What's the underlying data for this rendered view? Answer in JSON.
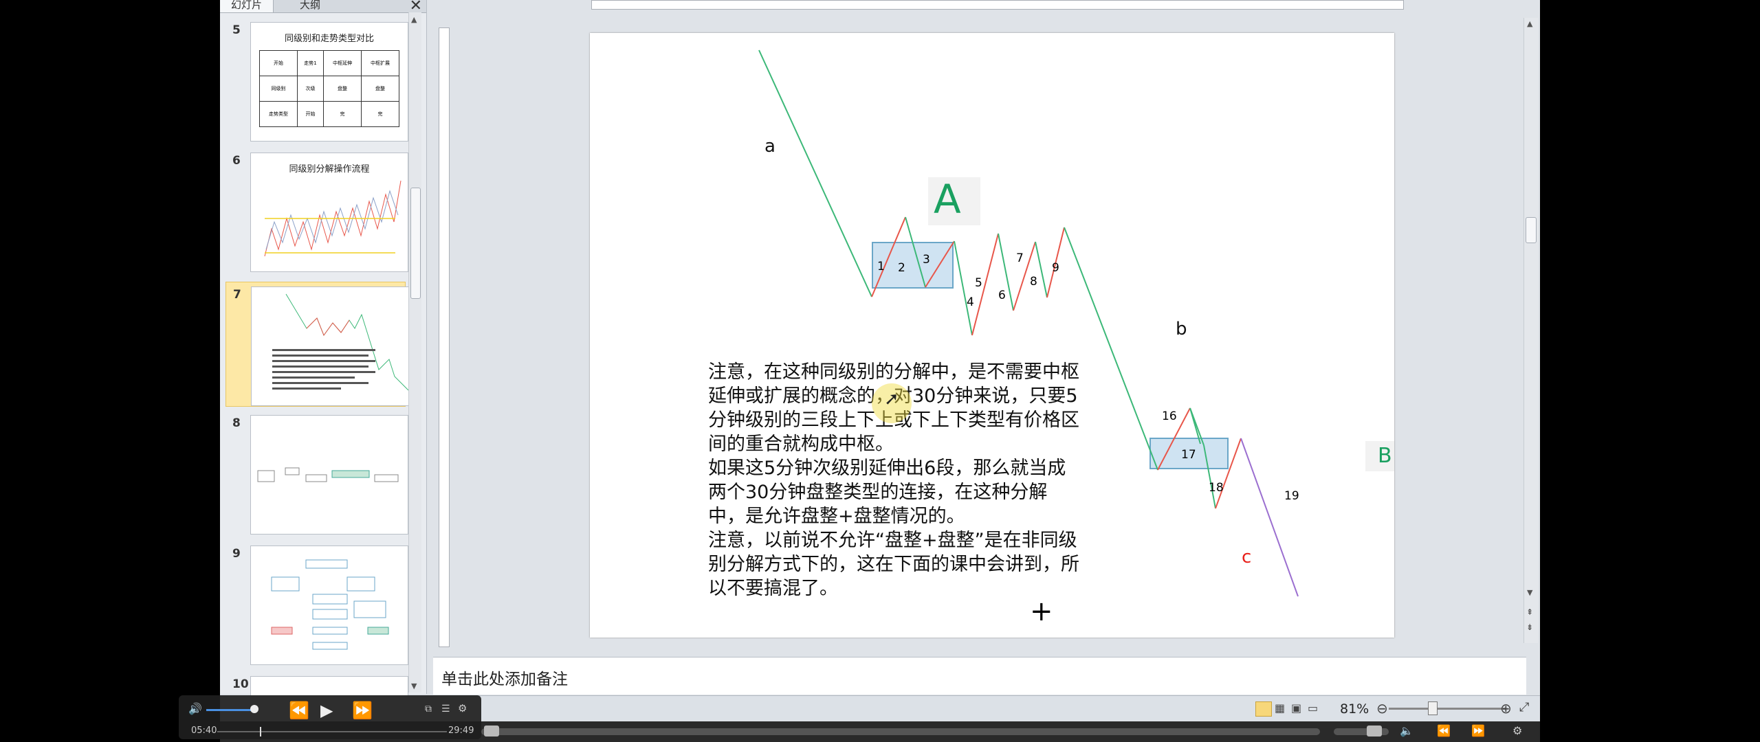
{
  "panel": {
    "tabs": [
      "幻灯片",
      "大纲"
    ],
    "slides": [
      {
        "num": "5",
        "title": "同级别和走势类型对比",
        "table": [
          [
            "开始",
            "走势1",
            "中枢延伸",
            "中枢扩展"
          ],
          [
            "同级别",
            "次级",
            "盘整",
            "盘整"
          ],
          [
            "走势类型",
            "开始",
            "完",
            "完"
          ]
        ]
      },
      {
        "num": "6",
        "title": "同级别分解操作流程"
      },
      {
        "num": "7",
        "title": ""
      },
      {
        "num": "8",
        "title": ""
      },
      {
        "num": "9",
        "title": ""
      },
      {
        "num": "10",
        "title": ""
      }
    ]
  },
  "slide": {
    "labels": {
      "a": "a",
      "A": "A",
      "b": "b",
      "B": "B",
      "c": "c",
      "n1": "1",
      "n2": "2",
      "n3": "3",
      "n4": "4",
      "n5": "5",
      "n6": "6",
      "n7": "7",
      "n8": "8",
      "n9": "9",
      "n16": "16",
      "n17": "17",
      "n18": "18",
      "n19": "19"
    },
    "paragraphs": [
      "注意，在这种同级别的分解中，是不需要中枢延伸或扩展的概念的，对30分钟来说，只要5分钟级别的三段上下上或下上下类型有价格区间的重合就构成中枢。",
      "如果这5分钟次级别延伸出6段，那么就当成两个30分钟盘整类型的连接，在这种分解中，是允许盘整+盘整情况的。",
      "注意，以前说不允许“盘整+盘整”是在非同级别分解方式下的，这在下面的课中会讲到，所以不要搞混了。"
    ]
  },
  "notes": {
    "placeholder": "单击此处添加备注"
  },
  "status": {
    "zoom": "81%"
  },
  "video": {
    "current": "05:40",
    "total": "29:49"
  },
  "colors": {
    "up": "#e8564a",
    "down": "#3cb878",
    "purple": "#9b6fd0",
    "box_fill": "#cfe3f2",
    "box_stroke": "#6aa6c8",
    "highlight": "#f2f2f2"
  }
}
